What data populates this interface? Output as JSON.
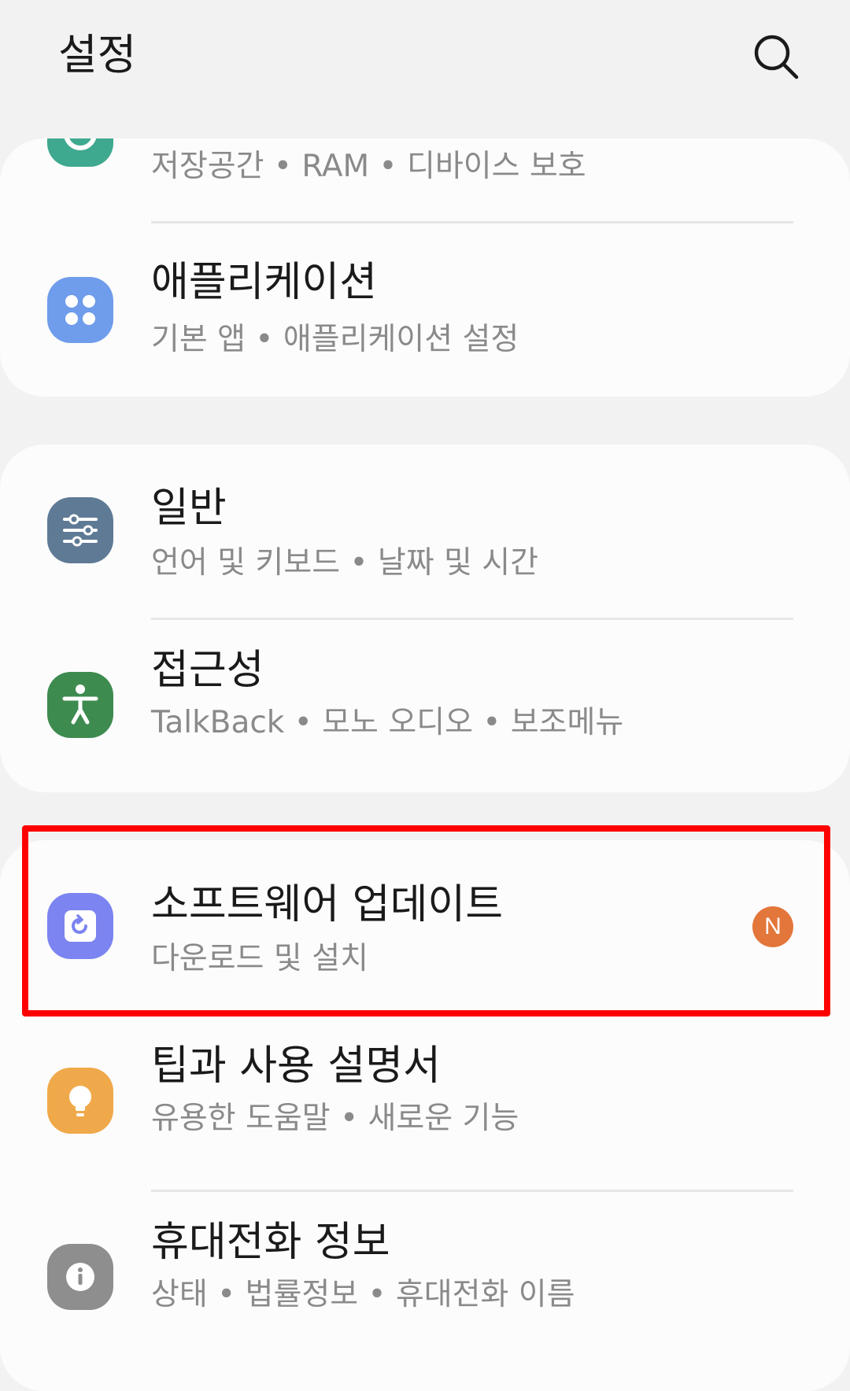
{
  "header": {
    "title": "설정",
    "search_icon": "search-icon"
  },
  "cards": [
    {
      "rows": [
        {
          "id": "device-care",
          "title": "",
          "subtitle": "저장공간  •  RAM  •  디바이스 보호",
          "icon": "device-care-icon",
          "icon_color": "#3fa98f"
        },
        {
          "id": "applications",
          "title": "애플리케이션",
          "subtitle": "기본 앱  •  애플리케이션 설정",
          "icon": "apps-grid-icon",
          "icon_color": "#6f9ceb"
        }
      ]
    },
    {
      "rows": [
        {
          "id": "general",
          "title": "일반",
          "subtitle": "언어 및 키보드  •  날짜 및 시간",
          "icon": "sliders-icon",
          "icon_color": "#5f7a95"
        },
        {
          "id": "accessibility",
          "title": "접근성",
          "subtitle": "TalkBack  •  모노 오디오  •  보조메뉴",
          "icon": "accessibility-icon",
          "icon_color": "#3e8b4f"
        }
      ]
    },
    {
      "rows": [
        {
          "id": "software-update",
          "title": "소프트웨어 업데이트",
          "subtitle": "다운로드 및 설치",
          "icon": "update-icon",
          "icon_color": "#7b84f0",
          "badge": "N",
          "badge_color": "#e3763a"
        },
        {
          "id": "tips",
          "title": "팁과 사용 설명서",
          "subtitle": "유용한 도움말  •  새로운 기능",
          "icon": "lightbulb-icon",
          "icon_color": "#f0a94a"
        },
        {
          "id": "about-phone",
          "title": "휴대전화 정보",
          "subtitle": "상태  •  법률정보  •  휴대전화 이름",
          "icon": "info-icon",
          "icon_color": "#8e8e8e"
        }
      ]
    }
  ],
  "highlight_color": "#ff0000"
}
